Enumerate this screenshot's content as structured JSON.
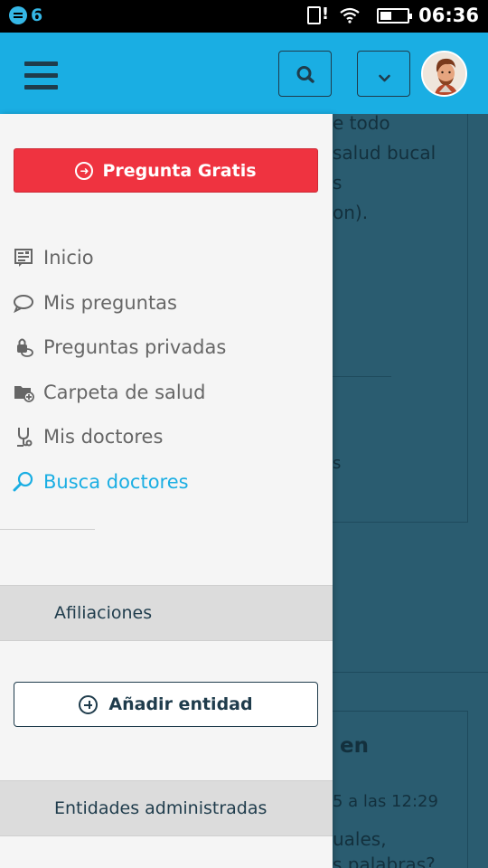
{
  "status_bar": {
    "notification_count": "6",
    "time": "06:36"
  },
  "app_bar": {
    "menu_icon": "hamburger-icon",
    "search_icon": "search-icon",
    "dropdown_icon": "chevron-down-icon",
    "avatar": "user-avatar"
  },
  "drawer": {
    "cta_label": "Pregunta Gratis",
    "nav": [
      {
        "label": "Inicio",
        "icon": "news-icon",
        "active": false
      },
      {
        "label": "Mis preguntas",
        "icon": "speech-bubble-icon",
        "active": false
      },
      {
        "label": "Preguntas privadas",
        "icon": "lock-chat-icon",
        "active": false
      },
      {
        "label": "Carpeta de salud",
        "icon": "folder-plus-icon",
        "active": false
      },
      {
        "label": "Mis doctores",
        "icon": "stethoscope-icon",
        "active": false
      },
      {
        "label": "Busca doctores",
        "icon": "magnifier-icon",
        "active": true
      }
    ],
    "affiliations_title": "Afiliaciones",
    "add_entity_label": "Añadir entidad",
    "managed_entities_title": "Entidades administradas"
  },
  "background": {
    "lines": [
      "e todo",
      "salud bucal",
      "s",
      "on).",
      "s",
      "en",
      "5 a las 12:29",
      "uales,",
      "s palabras?"
    ]
  },
  "colors": {
    "app_bar": "#1aaee3",
    "cta": "#ef3340",
    "active": "#1aaee3",
    "navy": "#1f3c4c"
  }
}
